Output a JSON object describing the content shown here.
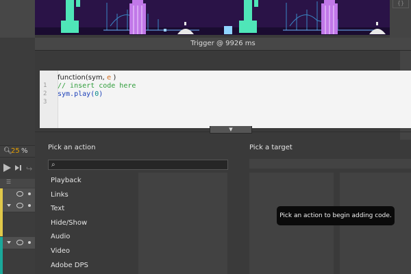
{
  "colors": {
    "stage_bg": "#2a1347",
    "accent_orange": "#e8a000",
    "track_yellow": "#e0c84a",
    "track_teal": "#1aa89a",
    "code_comment": "#2f9e3a",
    "code_keyword": "#1b3fb8"
  },
  "stage": {
    "icons": [
      "statue-of-liberty",
      "golden-gate-bridge",
      "skyscraper",
      "domed-building"
    ],
    "braces_label": "{}"
  },
  "zoom": {
    "value": "25",
    "unit": "%"
  },
  "dialog": {
    "title": "Trigger @ 9926 ms",
    "function_signature_prefix": "function(sym, ",
    "function_param": "e",
    "function_signature_suffix": " )",
    "line_numbers": [
      "1",
      "2",
      "3"
    ],
    "code_comment": "// insert code here",
    "code_call_prefix": "sym.play(",
    "code_call_arg": "0",
    "code_call_suffix": ")",
    "collapse_icon": "▼"
  },
  "actions": {
    "title": "Pick an action",
    "search_placeholder": "",
    "items": [
      "Playback",
      "Links",
      "Text",
      "Hide/Show",
      "Audio",
      "Video",
      "Adobe DPS"
    ]
  },
  "targets": {
    "title": "Pick a target"
  },
  "tooltip": "Pick an action to begin adding code."
}
